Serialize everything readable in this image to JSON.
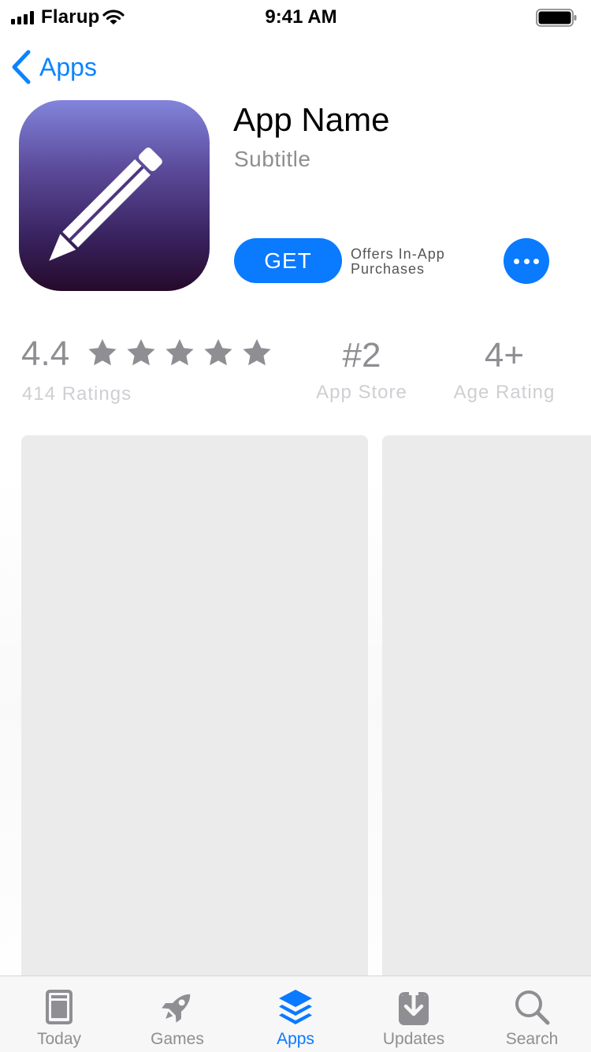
{
  "status_bar": {
    "carrier": "Flarup",
    "time": "9:41 AM"
  },
  "nav": {
    "back_label": "Apps"
  },
  "app": {
    "name": "App Name",
    "subtitle": "Subtitle",
    "get_label": "GET",
    "iap_line1": "Offers In-App",
    "iap_line2": "Purchases",
    "icon": "pencil-icon"
  },
  "ratings": {
    "value": "4.4",
    "stars": 5,
    "count_label": "414 Ratings",
    "rank": "#2",
    "rank_label": "App Store",
    "age": "4+",
    "age_label": "Age Rating"
  },
  "tab_bar": {
    "tabs": [
      {
        "label": "Today",
        "icon": "today-icon",
        "active": false
      },
      {
        "label": "Games",
        "icon": "rocket-icon",
        "active": false
      },
      {
        "label": "Apps",
        "icon": "layers-icon",
        "active": true
      },
      {
        "label": "Updates",
        "icon": "download-icon",
        "active": false
      },
      {
        "label": "Search",
        "icon": "search-icon",
        "active": false
      }
    ]
  },
  "colors": {
    "accent": "#0a7aff",
    "secondary_text": "#8e8e93",
    "placeholder": "#ebebeb"
  }
}
